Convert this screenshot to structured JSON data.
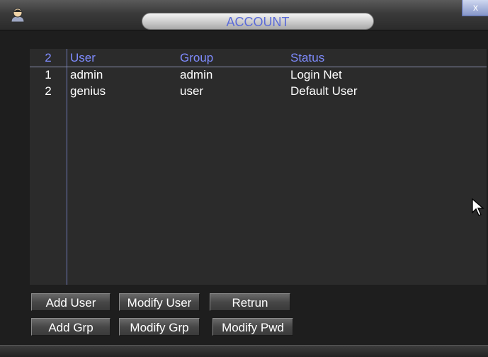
{
  "window": {
    "title": "ACCOUNT",
    "close_label": "x"
  },
  "table": {
    "header": {
      "num": "2",
      "user": "User",
      "group": "Group",
      "status": "Status"
    },
    "rows": [
      {
        "num": "1",
        "user": "admin",
        "group": "admin",
        "status": "Login Net"
      },
      {
        "num": "2",
        "user": "genius",
        "group": "user",
        "status": "Default User"
      }
    ]
  },
  "buttons": {
    "add_user": "Add User",
    "modify_user": "Modify User",
    "retrun": "Retrun",
    "add_grp": "Add Grp",
    "modify_grp": "Modify Grp",
    "modify_pwd": "Modify Pwd"
  },
  "icons": {
    "user_icon": "user-icon",
    "close_icon": "close-icon",
    "cursor": "mouse-cursor-icon"
  },
  "colors": {
    "title_text": "#5b6bd8",
    "header_text": "#7f8cff",
    "data_text": "#ffffff",
    "panel_bg": "#2b2b2b"
  }
}
